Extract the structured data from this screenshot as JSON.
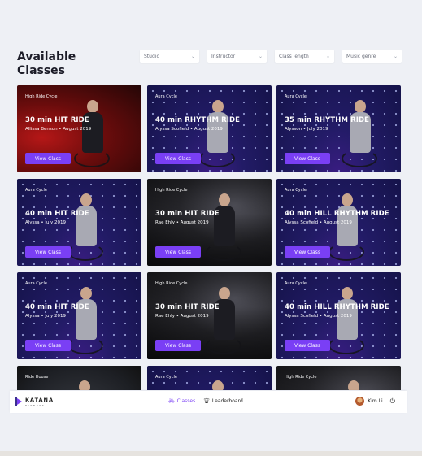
{
  "page": {
    "title": "Available Classes"
  },
  "filters": [
    {
      "label": "Studio"
    },
    {
      "label": "Instructor"
    },
    {
      "label": "Class length"
    },
    {
      "label": "Music genre"
    }
  ],
  "button_label": "View Class",
  "cards": [
    {
      "category": "High Ride Cycle",
      "name": "30 min HIT RIDE",
      "meta": "Allissa Benson • August 2019",
      "theme": "red"
    },
    {
      "category": "Aura Cycle",
      "name": "40 min RHYTHM RIDE",
      "meta": "Alyssa Scofield • August 2019",
      "theme": "aura"
    },
    {
      "category": "Aura Cycle",
      "name": "35 min RHYTHM RIDE",
      "meta": "Alysson • July 2019",
      "theme": "aura"
    },
    {
      "category": "Aura Cycle",
      "name": "40 min HIT RIDE",
      "meta": "Alyssa • July 2019",
      "theme": "aura"
    },
    {
      "category": "High Ride Cycle",
      "name": "30 min HIT RIDE",
      "meta": "Rae Ehly • August 2019",
      "theme": "hr"
    },
    {
      "category": "Aura Cycle",
      "name": "40 min HILL RHYTHM RIDE",
      "meta": "Alyssa Scofield • August 2019",
      "theme": "aura"
    },
    {
      "category": "Aura Cycle",
      "name": "40 min HIT RIDE",
      "meta": "Alyssa • July 2019",
      "theme": "aura"
    },
    {
      "category": "High Ride Cycle",
      "name": "30 min HIT RIDE",
      "meta": "Rae Ehly • August 2019",
      "theme": "hr"
    },
    {
      "category": "Aura Cycle",
      "name": "40 min HILL RHYTHM RIDE",
      "meta": "Alyssa Scofield • August 2019",
      "theme": "aura"
    },
    {
      "category": "Ride House",
      "name": "",
      "meta": "",
      "theme": "house"
    },
    {
      "category": "Aura Cycle",
      "name": "",
      "meta": "",
      "theme": "aura"
    },
    {
      "category": "High Ride Cycle",
      "name": "",
      "meta": "",
      "theme": "hr"
    }
  ],
  "footer": {
    "logo_text": "KATANA",
    "logo_sub": "FITNESS",
    "nav": [
      {
        "label": "Classes",
        "icon": "bike-icon",
        "active": true
      },
      {
        "label": "Leaderboard",
        "icon": "trophy-icon",
        "active": false
      }
    ],
    "user_name": "Kim Li"
  },
  "colors": {
    "accent": "#7a3ff5",
    "background": "#eef0f5"
  }
}
